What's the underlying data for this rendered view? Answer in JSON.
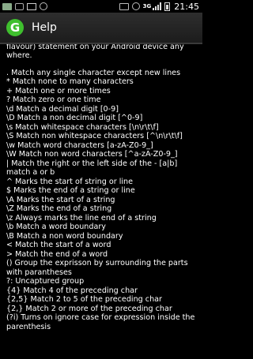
{
  "status_bar": {
    "left_icons": [
      "image-icon",
      "usb-icon",
      "mail-icon",
      "sync-icon"
    ],
    "right_icons": [
      "vibrate-icon",
      "alarm-icon"
    ],
    "network": "3G",
    "clock": "21:45"
  },
  "header": {
    "logo_letter": "G",
    "title": "Help"
  },
  "help": {
    "intro": "GREP on the run allows you to test GREP (Java flavour) statement on your Android device any where.",
    "lines": [
      ". Match any single character except new lines",
      "* Match none to many characters",
      "+ Match one or more times",
      "? Match zero or one time",
      "\\d Match a decimal digit [0-9]",
      "\\D Match a non decimal digit [^0-9]",
      "\\s Match whitespace characters [\\n\\r\\t\\f]",
      "\\S Match non whitespace characters [^\\n\\r\\t\\f]",
      "\\w Match word characters [a-zA-Z0-9_]",
      "\\W Match non word characters [^a-zA-Z0-9_]",
      "| Match the right or the left side of the  - [a|b] match a or b",
      "^ Marks the start of string or line",
      "$ Marks the end of a string or line",
      "\\A Marks the start of a string",
      "\\Z Marks the end of a string",
      "\\z Always marks the line end of a string",
      "\\b Match a word boundary",
      "\\B Match a non word boundary",
      "< Match the start of a word",
      "> Match the end of a word",
      "() Group the exprisson by surrounding the parts with parantheses",
      "?: Uncaptured group",
      "{4} Match 4 of the preceding char",
      "{2,5} Match 2 to 5 of the preceding char",
      "{2,} Match 2 or more of the preceding char",
      "(?i) Turns on ignore case for expression inside the parenthesis"
    ]
  }
}
